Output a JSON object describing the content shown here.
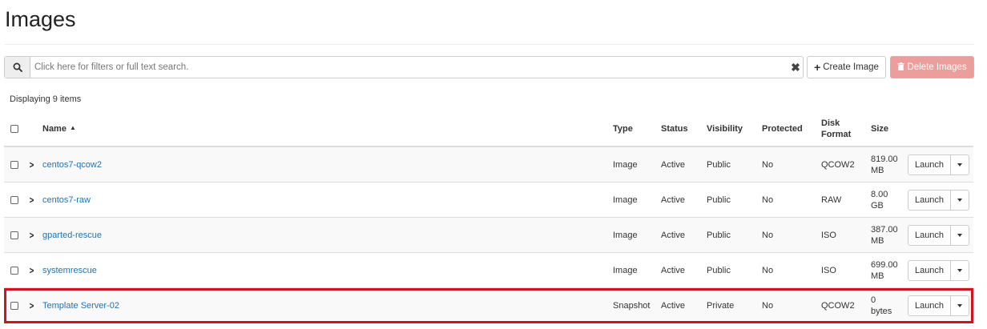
{
  "page": {
    "title": "Images"
  },
  "toolbar": {
    "search_placeholder": "Click here for filters or full text search.",
    "search_icon": "search-icon",
    "clear_icon": "close-icon",
    "clear_glyph": "✖",
    "create_label": "Create Image",
    "create_icon": "plus-icon",
    "delete_label": "Delete Images",
    "delete_icon": "trash-icon"
  },
  "table": {
    "count_text": "Displaying 9 items",
    "headers": {
      "name": "Name",
      "type": "Type",
      "status": "Status",
      "visibility": "Visibility",
      "protected": "Protected",
      "disk_format_1": "Disk",
      "disk_format_2": "Format",
      "size": "Size"
    },
    "rows": [
      {
        "name": "centos7-qcow2",
        "type": "Image",
        "status": "Active",
        "visibility": "Public",
        "protected": "No",
        "format": "QCOW2",
        "size_1": "819.00",
        "size_2": "MB",
        "action": "Launch"
      },
      {
        "name": "centos7-raw",
        "type": "Image",
        "status": "Active",
        "visibility": "Public",
        "protected": "No",
        "format": "RAW",
        "size_1": "8.00",
        "size_2": "GB",
        "action": "Launch"
      },
      {
        "name": "gparted-rescue",
        "type": "Image",
        "status": "Active",
        "visibility": "Public",
        "protected": "No",
        "format": "ISO",
        "size_1": "387.00",
        "size_2": "MB",
        "action": "Launch"
      },
      {
        "name": "systemrescue",
        "type": "Image",
        "status": "Active",
        "visibility": "Public",
        "protected": "No",
        "format": "ISO",
        "size_1": "699.00",
        "size_2": "MB",
        "action": "Launch"
      },
      {
        "name": "Template Server-02",
        "type": "Snapshot",
        "status": "Active",
        "visibility": "Private",
        "protected": "No",
        "format": "QCOW2",
        "size_1": "0",
        "size_2": "bytes",
        "action": "Launch"
      }
    ]
  },
  "colors": {
    "link": "#1f73b7",
    "highlight": "#d3121e",
    "danger_disabled": "#eb9e9b"
  }
}
